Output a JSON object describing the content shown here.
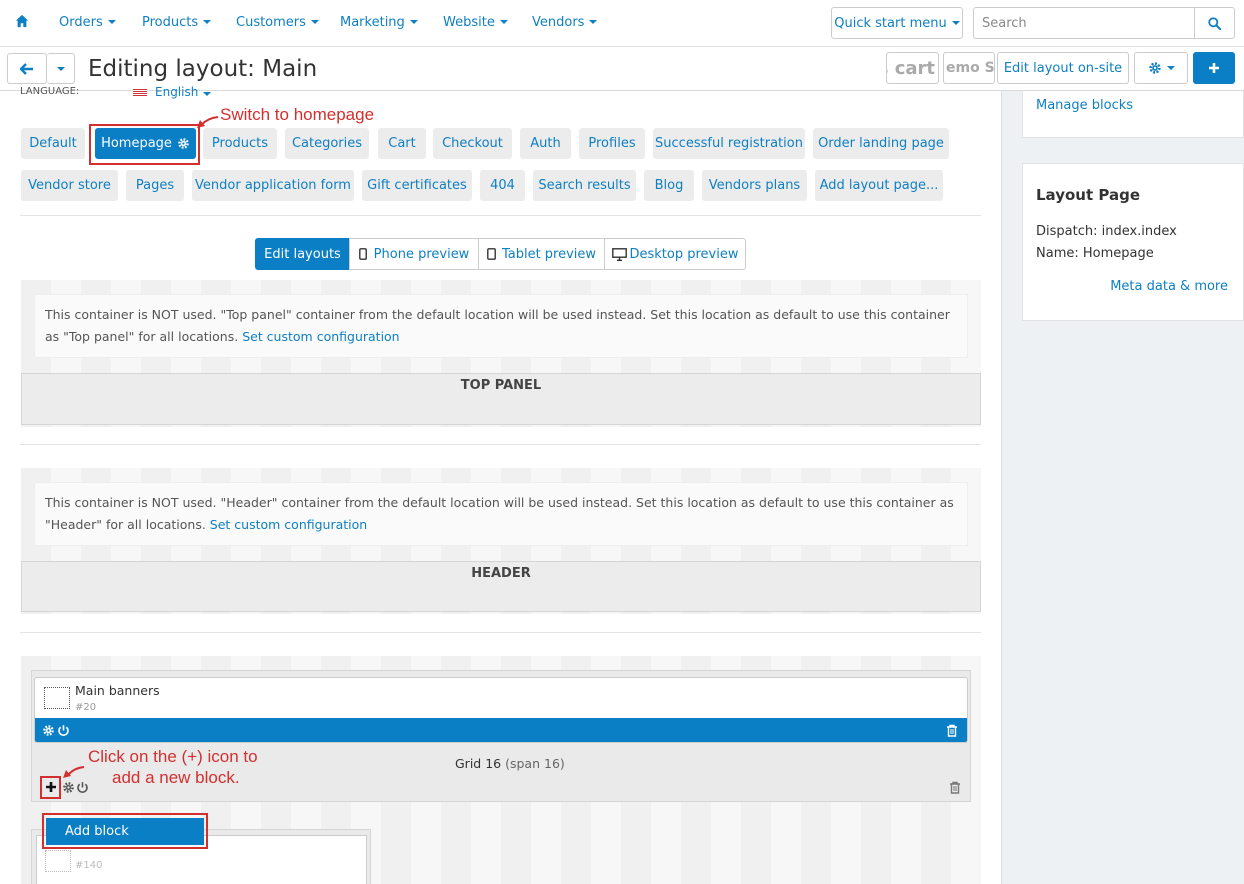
{
  "topnav": {
    "items": [
      {
        "label": "Orders"
      },
      {
        "label": "Products"
      },
      {
        "label": "Customers"
      },
      {
        "label": "Marketing"
      },
      {
        "label": "Website"
      },
      {
        "label": "Vendors"
      }
    ],
    "quick_start": "Quick start menu",
    "search_placeholder": "Search",
    "icons": {
      "home": "home-icon",
      "search": "search-icon"
    }
  },
  "subbar": {
    "title": "Editing layout: Main",
    "logo1": "s cart",
    "logo2": "emo Sto",
    "edit_onsite": "Edit layout on-site",
    "icons": {
      "back": "arrow-left-icon",
      "gear": "gear-icon",
      "plus": "plus-icon"
    }
  },
  "language": {
    "label": "LANGUAGE:",
    "value": "English"
  },
  "annotations": {
    "switch_homepage": "Switch to homepage",
    "click_plus_line1": "Click on the (+) icon to",
    "click_plus_line2": "add a new block."
  },
  "layout_tabs": {
    "row1": [
      "Default",
      "Homepage",
      "Products",
      "Categories",
      "Cart",
      "Checkout",
      "Auth",
      "Profiles",
      "Successful registration",
      "Order landing page"
    ],
    "row2": [
      "Vendor store",
      "Pages",
      "Vendor application form",
      "Gift certificates",
      "404",
      "Search results",
      "Blog",
      "Vendors plans",
      "Add layout page..."
    ],
    "active": "Homepage"
  },
  "preview_modes": [
    "Edit layouts",
    "Phone preview",
    "Tablet preview",
    "Desktop preview"
  ],
  "containers": {
    "top_panel": {
      "notice": "This container is NOT used. \"Top panel\" container from the default location will be used instead. Set this location as default to use this container as \"Top panel\" for all locations.",
      "link": "Set custom configuration",
      "title": "TOP PANEL"
    },
    "header": {
      "notice": "This container is NOT used. \"Header\" container from the default location will be used instead. Set this location as default to use this container as \"Header\" for all locations.",
      "link": "Set custom configuration",
      "title": "HEADER"
    }
  },
  "blocks": {
    "main_banners": {
      "name": "Main banners",
      "id": "#20"
    },
    "grid": {
      "name": "Grid 16",
      "span": "(span 16)"
    },
    "second_block_id": "#140"
  },
  "add_block": "Add block",
  "right_panel": {
    "manage_blocks": "Manage blocks",
    "layout_page": {
      "heading": "Layout Page",
      "dispatch": "Dispatch: index.index",
      "name": "Name: Homepage",
      "meta": "Meta data & more"
    }
  },
  "colors": {
    "accent": "#0a7fc6",
    "link": "#0f7fc3",
    "annotation": "#d32f2f"
  }
}
